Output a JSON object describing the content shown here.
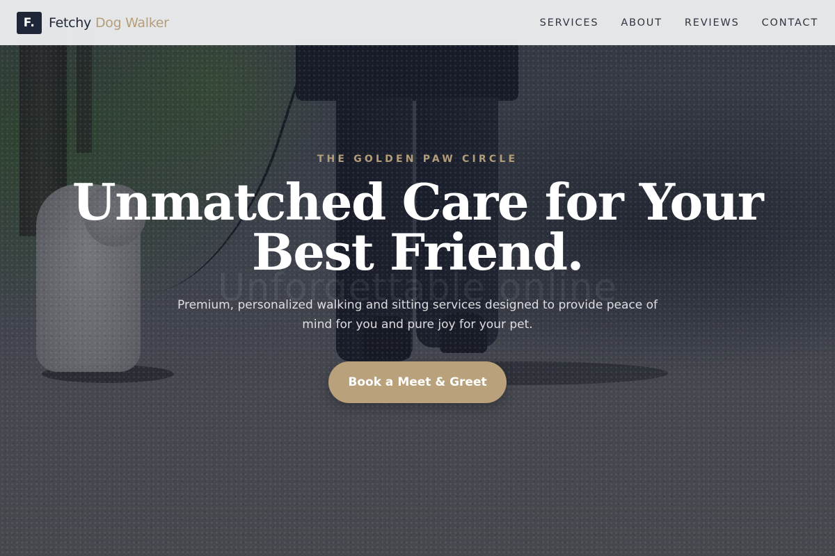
{
  "brand": {
    "logo_mark": "F.",
    "name_primary": "Fetchy",
    "name_accent": "Dog Walker"
  },
  "nav": {
    "items": [
      {
        "label": "SERVICES"
      },
      {
        "label": "ABOUT"
      },
      {
        "label": "REVIEWS"
      },
      {
        "label": "CONTACT"
      }
    ]
  },
  "hero": {
    "eyebrow": "THE GOLDEN PAW CIRCLE",
    "headline_line1": "Unmatched Care for Your",
    "headline_line2": "Best Friend.",
    "ghost_text": "Unforgettable online",
    "subtext": "Premium, personalized walking and sitting services designed to provide peace of mind for you and pure joy for your pet.",
    "cta_label": "Book a Meet & Greet"
  },
  "colors": {
    "navy": "#1e2638",
    "gold_accent": "#b49d79",
    "cta_background": "#b9a17c",
    "navbar_background": "#ecedef"
  },
  "icons": {
    "logo": "letter-f-square-icon"
  }
}
